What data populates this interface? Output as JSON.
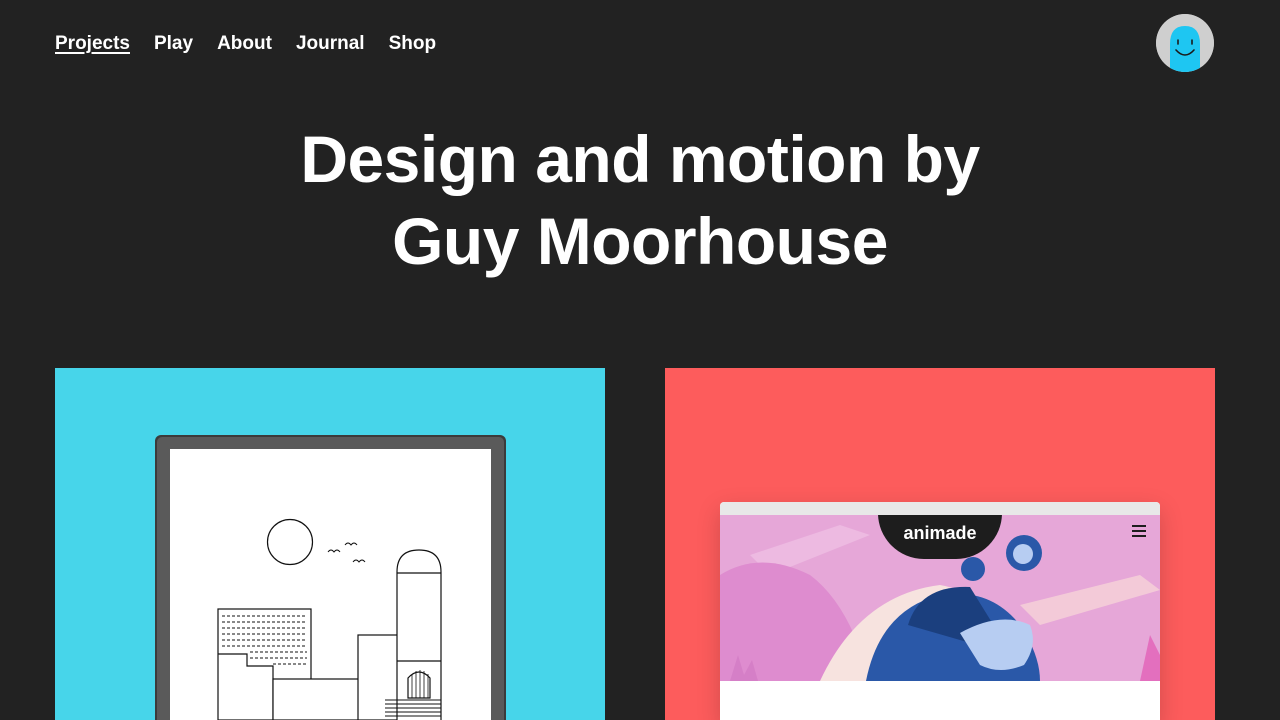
{
  "nav": {
    "items": [
      {
        "label": "Projects",
        "active": true
      },
      {
        "label": "Play",
        "active": false
      },
      {
        "label": "About",
        "active": false
      },
      {
        "label": "Journal",
        "active": false
      },
      {
        "label": "Shop",
        "active": false
      }
    ]
  },
  "avatar": {
    "icon": "smiling-face-avatar-icon",
    "color": "#1ec6f2"
  },
  "hero": {
    "line1": "Design and motion by",
    "line2": "Guy Moorhouse"
  },
  "projects": [
    {
      "background": "#47d5ea",
      "illustration": "ereader-cityscape-drawing"
    },
    {
      "background": "#fd5c5c",
      "site_logo": "animade",
      "logo_mark": "∞",
      "menu_icon": "hamburger-menu-icon"
    }
  ],
  "colors": {
    "page_bg": "#222222",
    "text": "#ffffff",
    "accent_cyan": "#47d5ea",
    "accent_coral": "#fd5c5c"
  }
}
